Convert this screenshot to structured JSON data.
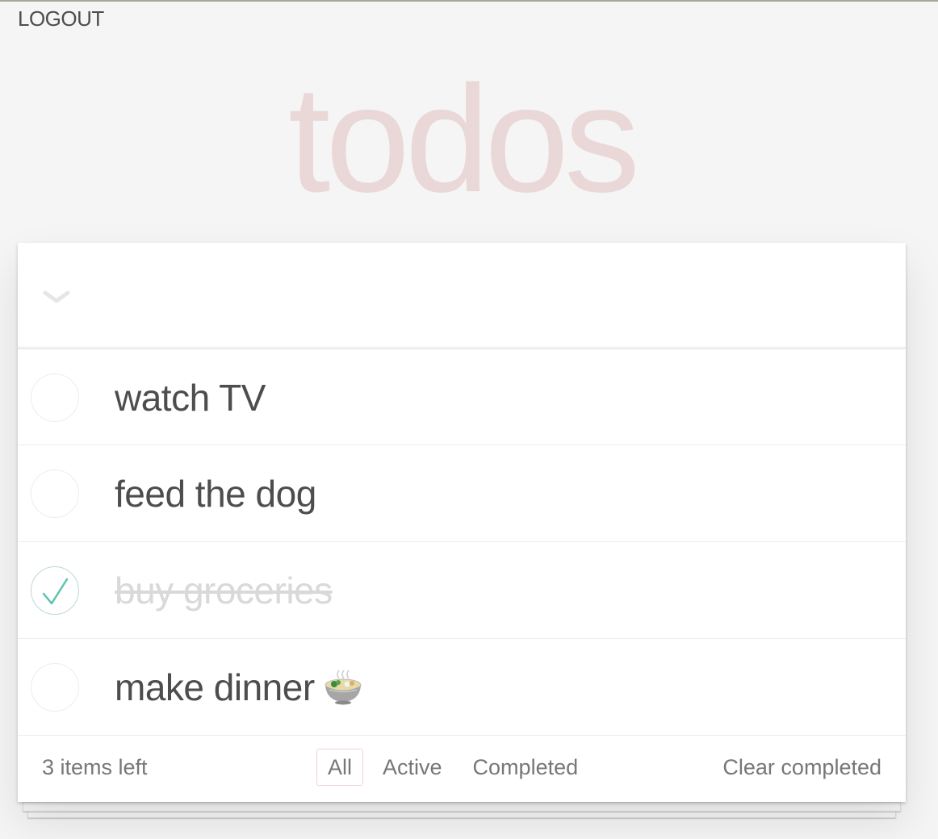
{
  "header": {
    "logout_label": "LOGOUT",
    "app_title": "todos"
  },
  "new_todo": {
    "value": "",
    "placeholder": ""
  },
  "toggle_all_icon": "chevron-down-icon",
  "todos": [
    {
      "text": "watch TV",
      "completed": false
    },
    {
      "text": "feed the dog",
      "completed": false
    },
    {
      "text": "buy groceries",
      "completed": true
    },
    {
      "text": "make dinner",
      "completed": false,
      "emoji": "steaming-bowl-icon"
    }
  ],
  "footer": {
    "items_left": "3 items left",
    "filters": [
      {
        "label": "All",
        "selected": true
      },
      {
        "label": "Active",
        "selected": false
      },
      {
        "label": "Completed",
        "selected": false
      }
    ],
    "clear_completed": "Clear completed"
  },
  "colors": {
    "title": "#efdcdc",
    "checked_circle": "#bddad5",
    "checkmark": "#5dc2af",
    "selected_filter_border": "#efd5d5"
  }
}
